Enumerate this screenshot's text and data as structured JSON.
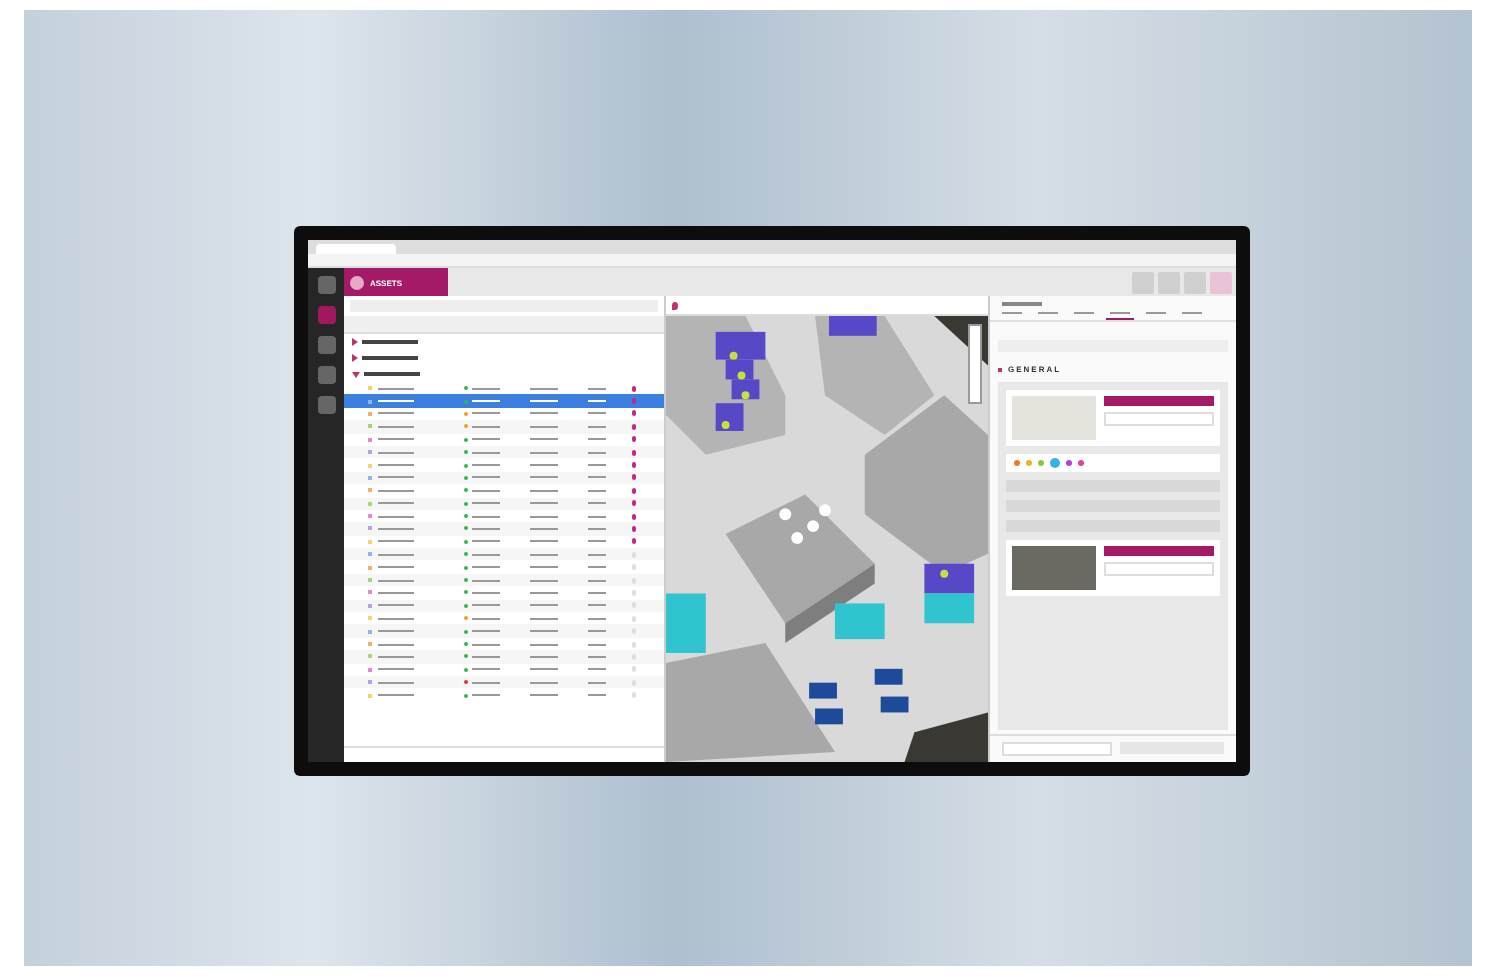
{
  "app": {
    "section": "ASSETS"
  },
  "list": {
    "groups": [
      {
        "expanded": false
      },
      {
        "expanded": false
      },
      {
        "expanded": true
      }
    ],
    "rows": [
      {
        "selected": false,
        "color": "#2fb84a",
        "on_map": true
      },
      {
        "selected": true,
        "color": "#2fb84a",
        "on_map": true
      },
      {
        "selected": false,
        "color": "#f0a020",
        "on_map": true
      },
      {
        "selected": false,
        "color": "#f0a020",
        "on_map": true
      },
      {
        "selected": false,
        "color": "#2fb84a",
        "on_map": true
      },
      {
        "selected": false,
        "color": "#2fb84a",
        "on_map": true
      },
      {
        "selected": false,
        "color": "#2fb84a",
        "on_map": true
      },
      {
        "selected": false,
        "color": "#2fb84a",
        "on_map": true
      },
      {
        "selected": false,
        "color": "#2fb84a",
        "on_map": true
      },
      {
        "selected": false,
        "color": "#2fb84a",
        "on_map": true
      },
      {
        "selected": false,
        "color": "#2fb84a",
        "on_map": true
      },
      {
        "selected": false,
        "color": "#2fb84a",
        "on_map": true
      },
      {
        "selected": false,
        "color": "#2fb84a",
        "on_map": true
      },
      {
        "selected": false,
        "color": "#2fb84a",
        "on_map": false
      },
      {
        "selected": false,
        "color": "#2fb84a",
        "on_map": false
      },
      {
        "selected": false,
        "color": "#2fb84a",
        "on_map": false
      },
      {
        "selected": false,
        "color": "#2fb84a",
        "on_map": false
      },
      {
        "selected": false,
        "color": "#2fb84a",
        "on_map": false
      },
      {
        "selected": false,
        "color": "#f0a020",
        "on_map": false
      },
      {
        "selected": false,
        "color": "#2fb84a",
        "on_map": false
      },
      {
        "selected": false,
        "color": "#2fb84a",
        "on_map": false
      },
      {
        "selected": false,
        "color": "#2fb84a",
        "on_map": false
      },
      {
        "selected": false,
        "color": "#2fb84a",
        "on_map": false
      },
      {
        "selected": false,
        "color": "#e03030",
        "on_map": false
      },
      {
        "selected": false,
        "color": "#2fb84a",
        "on_map": false
      }
    ]
  },
  "details": {
    "tabs": [
      {
        "selected": false
      },
      {
        "selected": false
      },
      {
        "selected": false
      },
      {
        "selected": true
      },
      {
        "selected": false
      },
      {
        "selected": false
      }
    ],
    "section_title": "GENERAL",
    "swatches": [
      {
        "color": "#f07a20",
        "selected": false
      },
      {
        "color": "#f0b020",
        "selected": false
      },
      {
        "color": "#8cc63f",
        "selected": false
      },
      {
        "color": "#3ab0e8",
        "selected": true
      },
      {
        "color": "#b040e0",
        "selected": false
      },
      {
        "color": "#e040a0",
        "selected": false
      }
    ]
  }
}
